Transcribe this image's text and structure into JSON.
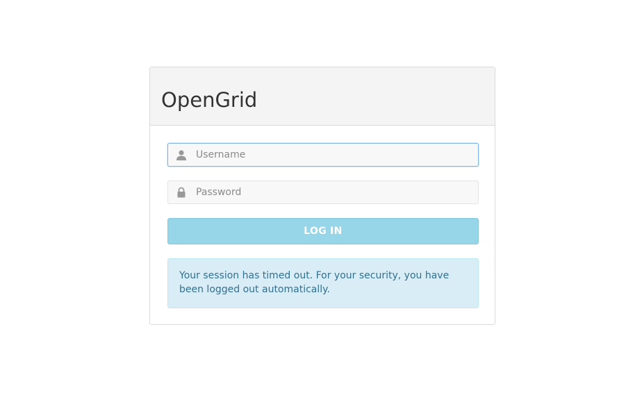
{
  "panel": {
    "title": "OpenGrid"
  },
  "form": {
    "username": {
      "placeholder": "Username",
      "value": "",
      "icon": "user-icon"
    },
    "password": {
      "placeholder": "Password",
      "value": "",
      "icon": "lock-icon"
    },
    "login_label": "LOG IN"
  },
  "alert": {
    "message": "Your session has timed out. For your security, you have been logged out automatically."
  },
  "colors": {
    "button_bg": "#96d6e8",
    "alert_bg": "#d9edf7",
    "alert_text": "#31708f",
    "focus_border": "#7fb7e0"
  }
}
